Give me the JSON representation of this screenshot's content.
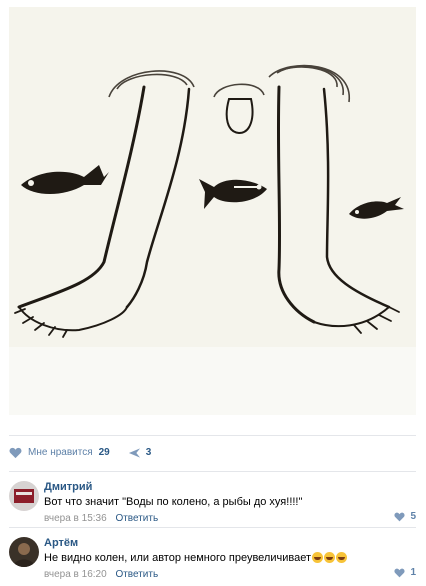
{
  "post": {
    "likes_label": "Мне нравится",
    "likes_count": "29",
    "shares_count": "3"
  },
  "comments": [
    {
      "author": "Дмитрий",
      "text": "Вот что значит \"Воды по колено, а рыбы до хуя!!!!\"",
      "time": "вчера в 15:36",
      "reply_label": "Ответить",
      "likes": "5"
    },
    {
      "author": "Артём",
      "text": "Не видно колен, или автор немного преувеличивает",
      "emoji_count": 3,
      "time": "вчера в 16:20",
      "reply_label": "Ответить",
      "likes": "1"
    }
  ],
  "colors": {
    "link": "#2a5885",
    "muted": "#939393",
    "image_bg": "#f5f4ec"
  },
  "icons": [
    "heart-icon",
    "share-icon",
    "avatar",
    "laughing-emoji"
  ]
}
